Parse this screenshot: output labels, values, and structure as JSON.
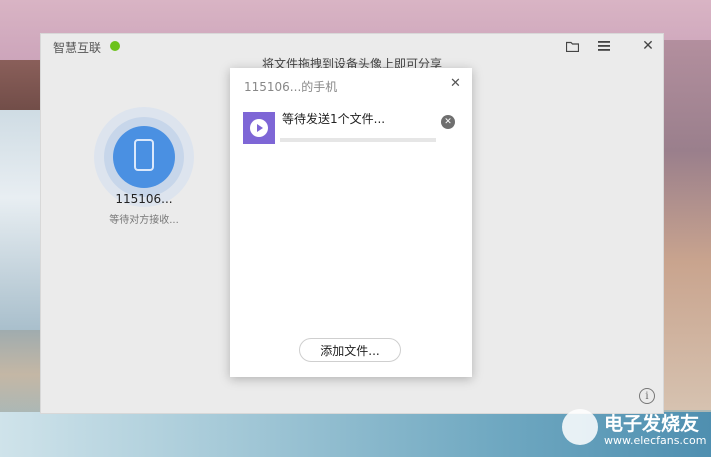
{
  "app": {
    "title": "智慧互联",
    "status_color": "#6cc21b",
    "icons": {
      "folder": "folder-icon",
      "menu": "menu-icon",
      "close": "close-icon"
    }
  },
  "hint": {
    "text": "将文件拖拽到设备头像上即可分享"
  },
  "device": {
    "name": "115106...",
    "status": "等待对方接收..."
  },
  "dialog": {
    "title": "115106...的手机",
    "file": {
      "label": "等待发送1个文件...",
      "progress": 0
    },
    "add_button": "添加文件..."
  },
  "watermark": {
    "brand": "电子发烧友",
    "url": "www.elecfans.com"
  }
}
